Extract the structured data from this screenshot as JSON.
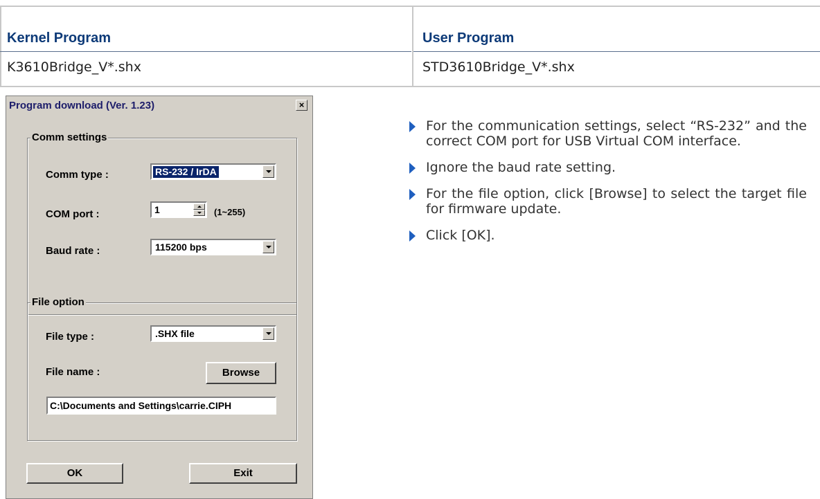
{
  "table": {
    "headers": [
      "Kernel Program",
      "User Program"
    ],
    "cells": [
      "K3610Bridge_V*.shx",
      "STD3610Bridge_V*.shx"
    ]
  },
  "dialog": {
    "title": "Program download  (Ver. 1.23)",
    "close_glyph": "×",
    "comm_group": "Comm settings",
    "comm_type_label": "Comm type :",
    "comm_type_value": "RS-232 / IrDA",
    "com_port_label": "COM port :",
    "com_port_value": "1",
    "com_port_range": "(1~255)",
    "baud_label": "Baud rate :",
    "baud_value": "115200 bps",
    "file_group": "File option",
    "file_type_label": "File type :",
    "file_type_value": ".SHX file",
    "file_name_label": "File name :",
    "browse_label": "Browse",
    "file_path_value": "C:\\Documents and Settings\\carrie.CIPH",
    "ok_label": "OK",
    "exit_label": "Exit"
  },
  "bullets": [
    "For the communication settings, select “RS-232” and the correct COM port for USB Virtual COM interface.",
    "Ignore the baud rate setting.",
    "For the file option, click [Browse] to select the target file for firmware update.",
    "Click [OK]."
  ],
  "colors": {
    "header_text": "#0d3a78",
    "bullet_arrow": "#1f5fbf",
    "dialog_bg": "#d4d0c8",
    "selection": "#0a246a"
  }
}
